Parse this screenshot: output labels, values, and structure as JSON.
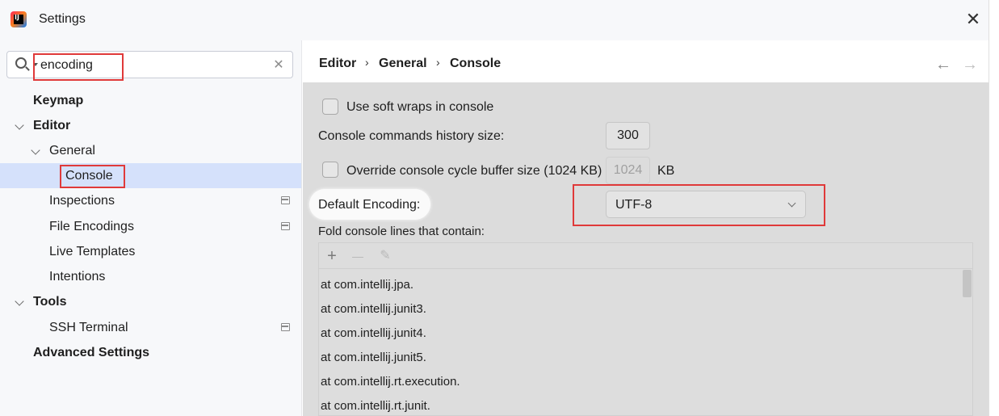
{
  "window": {
    "title": "Settings"
  },
  "search": {
    "value": "encoding",
    "placeholder": ""
  },
  "sidebar": {
    "items": [
      {
        "label": "Keymap"
      },
      {
        "label": "Editor"
      },
      {
        "label": "General"
      },
      {
        "label": "Console"
      },
      {
        "label": "Inspections"
      },
      {
        "label": "File Encodings"
      },
      {
        "label": "Live Templates"
      },
      {
        "label": "Intentions"
      },
      {
        "label": "Tools"
      },
      {
        "label": "SSH Terminal"
      },
      {
        "label": "Advanced Settings"
      }
    ],
    "selected": "Console"
  },
  "breadcrumb": {
    "items": [
      "Editor",
      "General",
      "Console"
    ],
    "separator": "›"
  },
  "nav": {
    "back": "←",
    "forward": "→"
  },
  "settings": {
    "soft_wraps": {
      "label": "Use soft wraps in console",
      "checked": false
    },
    "history": {
      "label": "Console commands history size:",
      "value": "300"
    },
    "cycle_buffer": {
      "label": "Override console cycle buffer size (1024 KB)",
      "value": "1024",
      "unit": "KB",
      "checked": false
    },
    "encoding": {
      "label": "Default Encoding:",
      "value": "UTF-8"
    },
    "fold": {
      "label": "Fold console lines that contain:",
      "toolbar": {
        "add": "+",
        "remove": "—",
        "edit": "✎"
      },
      "items": [
        "at com.intellij.jpa.",
        "at com.intellij.junit3.",
        "at com.intellij.junit4.",
        "at com.intellij.junit5.",
        "at com.intellij.rt.execution.",
        "at com.intellij.rt.junit."
      ]
    }
  },
  "colors": {
    "selection": "#d5e1fb",
    "highlight_box": "#e03a3a",
    "content_bg": "#dcdcdc"
  },
  "icons": [
    "intellij-logo-icon",
    "close-icon",
    "search-icon",
    "clear-icon",
    "chevron-down-icon",
    "chevron-right-icon",
    "project-level-icon",
    "back-arrow-icon",
    "forward-arrow-icon",
    "add-icon",
    "remove-icon",
    "edit-icon",
    "dropdown-icon"
  ]
}
